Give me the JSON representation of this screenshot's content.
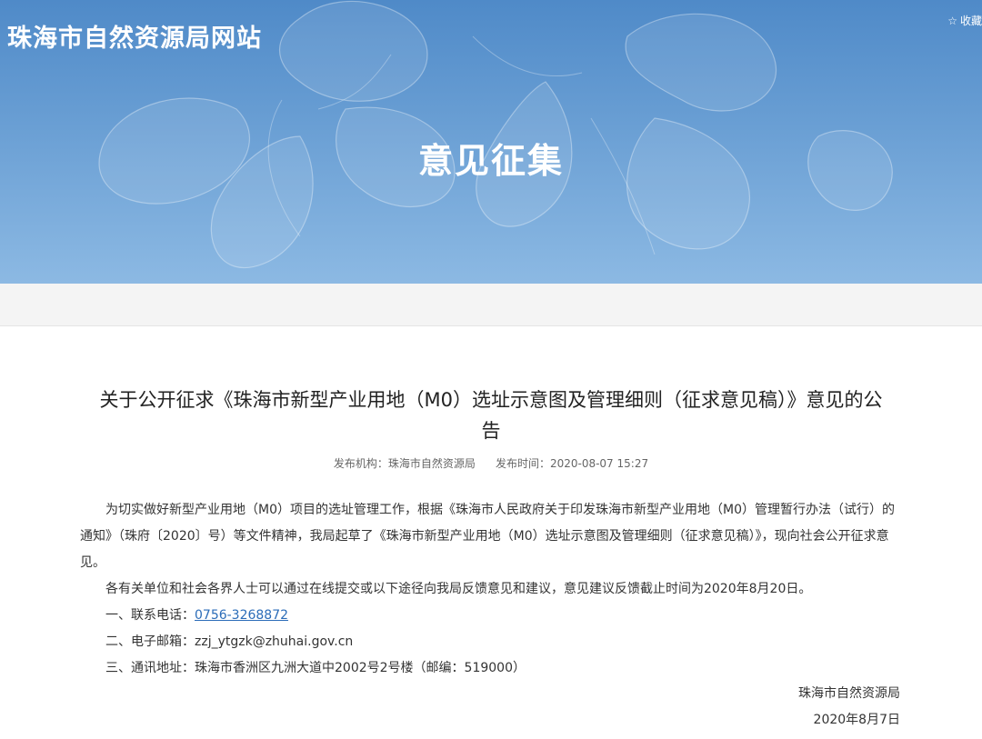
{
  "header": {
    "site_title": "珠海市自然资源局网站",
    "favorite_label": "收藏",
    "channel_title": "意见征集"
  },
  "article": {
    "title_line1": "关于公开征求《珠海市新型产业用地（M0）选址示意图及管理细则（征求意见稿）》意见的公",
    "title_line2": "告",
    "publisher_label": "发布机构：",
    "publisher": "珠海市自然资源局",
    "time_label": "发布时间：",
    "time": "2020-08-07 15:27",
    "paragraph1": "为切实做好新型产业用地（M0）项目的选址管理工作，根据《珠海市人民政府关于印发珠海市新型产业用地（M0）管理暂行办法（试行）的通知》（珠府〔2020〕号）等文件精神，我局起草了《珠海市新型产业用地（M0）选址示意图及管理细则（征求意见稿）》，现向社会公开征求意见。",
    "paragraph2": "各有关单位和社会各界人士可以通过在线提交或以下途径向我局反馈意见和建议，意见建议反馈截止时间为2020年8月20日。",
    "phone_label": "一、联系电话：",
    "phone": "0756-3268872",
    "email_label": "二、电子邮箱：",
    "email": "zzj_ytgzk@zhuhai.gov.cn",
    "address_label": "三、通讯地址：",
    "address": "珠海市香洲区九洲大道中2002号2号楼（邮编：519000）",
    "signoff_org": "珠海市自然资源局",
    "signoff_date": "2020年8月7日"
  },
  "colors": {
    "banner_top": "#4f8ac8",
    "banner_bottom": "#8cb9e3",
    "link": "#2b6cb8"
  },
  "icons": {
    "favorite": "star-outline-icon"
  }
}
